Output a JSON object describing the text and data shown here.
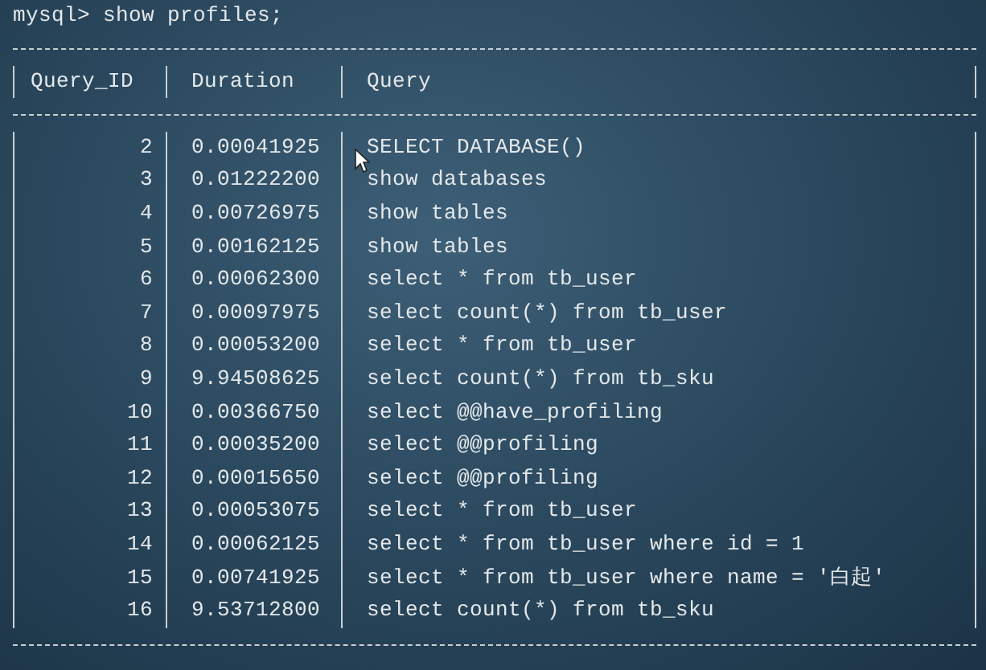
{
  "terminal": {
    "command_line": "mysql> show profiles;"
  },
  "table": {
    "columns": [
      "Query_ID",
      "Duration",
      "Query"
    ],
    "rows": [
      {
        "query_id": "2",
        "duration": "0.00041925",
        "query": "SELECT DATABASE()"
      },
      {
        "query_id": "3",
        "duration": "0.01222200",
        "query": "show databases"
      },
      {
        "query_id": "4",
        "duration": "0.00726975",
        "query": "show tables"
      },
      {
        "query_id": "5",
        "duration": "0.00162125",
        "query": "show tables"
      },
      {
        "query_id": "6",
        "duration": "0.00062300",
        "query": "select * from tb_user"
      },
      {
        "query_id": "7",
        "duration": "0.00097975",
        "query": "select count(*) from tb_user"
      },
      {
        "query_id": "8",
        "duration": "0.00053200",
        "query": "select * from tb_user"
      },
      {
        "query_id": "9",
        "duration": "9.94508625",
        "query": "select count(*) from tb_sku"
      },
      {
        "query_id": "10",
        "duration": "0.00366750",
        "query": "select @@have_profiling"
      },
      {
        "query_id": "11",
        "duration": "0.00035200",
        "query": "select @@profiling"
      },
      {
        "query_id": "12",
        "duration": "0.00015650",
        "query": "select @@profiling"
      },
      {
        "query_id": "13",
        "duration": "0.00053075",
        "query": "select * from tb_user"
      },
      {
        "query_id": "14",
        "duration": "0.00062125",
        "query": "select * from tb_user where id = 1"
      },
      {
        "query_id": "15",
        "duration": "0.00741925",
        "query": "select * from tb_user where name = '白起'"
      },
      {
        "query_id": "16",
        "duration": "9.53712800",
        "query": "select count(*) from tb_sku"
      }
    ]
  }
}
